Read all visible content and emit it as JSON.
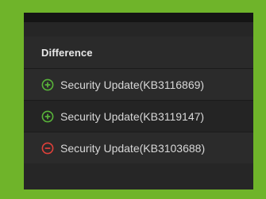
{
  "header": {
    "title": "Difference"
  },
  "updates": [
    {
      "label": "Security Update(KB3116869)",
      "icon": "plus-circle-icon",
      "status": "added",
      "color": "#59b43a"
    },
    {
      "label": "Security Update(KB3119147)",
      "icon": "plus-circle-icon",
      "status": "added",
      "color": "#59b43a"
    },
    {
      "label": "Security Update(KB3103688)",
      "icon": "minus-circle-icon",
      "status": "removed",
      "color": "#e0403a"
    }
  ]
}
